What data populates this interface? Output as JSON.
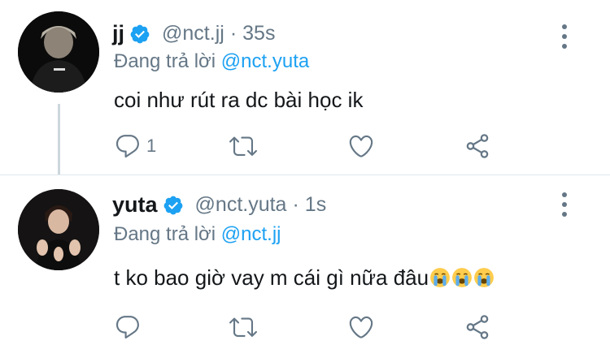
{
  "tweets": [
    {
      "name": "jj",
      "handle": "@nct.jj",
      "separator": "·",
      "time": "35s",
      "replying_prefix": "Đang trả lời ",
      "replying_to": "@nct.yuta",
      "text": "coi như rút ra dc bài học ik",
      "emojis": [],
      "reply_count": "1",
      "avatar_icon": "profile-photo"
    },
    {
      "name": "yuta",
      "handle": "@nct.yuta",
      "separator": "·",
      "time": "1s",
      "replying_prefix": "Đang trả lời ",
      "replying_to": "@nct.jj",
      "text": "t ko bao giờ vay m cái gì nữa đâu",
      "emojis": [
        "loudly-crying-face",
        "loudly-crying-face",
        "loudly-crying-face"
      ],
      "reply_count": "",
      "avatar_icon": "profile-photo"
    }
  ],
  "colors": {
    "accent": "#1da1f2",
    "muted": "#657786",
    "text": "#14171a",
    "divider": "#e1e8ed",
    "emoji_face": "#ffcc4d"
  },
  "icons": {
    "verified": "verified-badge-icon",
    "reply": "reply-icon",
    "retweet": "retweet-icon",
    "like": "heart-icon",
    "share": "share-icon",
    "more": "more-vertical-icon"
  }
}
